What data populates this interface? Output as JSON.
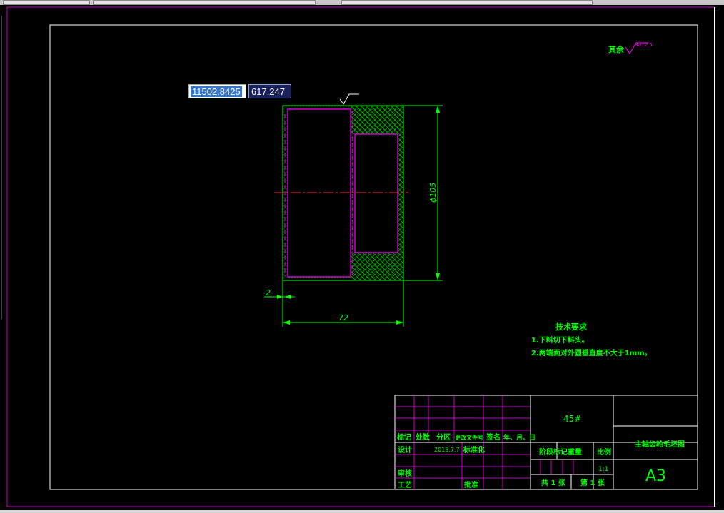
{
  "coords": {
    "x": "11502.8425",
    "y": "617.247"
  },
  "drawing": {
    "roughness_label": "其余",
    "roughness_value": "Ra12.5",
    "dim_diameter": "ϕ105",
    "dim_width": "72",
    "dim_offset": "2"
  },
  "tech": {
    "title": "技术要求",
    "items": [
      "1.下料切下料头。",
      "2.两端面对外圆垂直度不大于1mm。"
    ]
  },
  "title_block": {
    "material": "45#",
    "part_name": "主轴齿轮毛坯图",
    "sheet_size": "A3",
    "scale": "1:1",
    "date": "2019.7.7",
    "headers": [
      "标记",
      "处数",
      "分区",
      "更改文件号",
      "签名",
      "年、月、日"
    ],
    "design": "设计",
    "standardize": "标准化",
    "review": "审核",
    "process": "工艺",
    "approve": "批准",
    "stage": "阶段标记",
    "weight": "重量",
    "ratio": "比例",
    "total_sheets": "共 1 张",
    "sheet_no": "第 1 张"
  },
  "colors": {
    "frame": "#ffffff",
    "dimension": "#00ff00",
    "outline": "#ff00ff",
    "center": "#ff3333",
    "hatch": "#00cc00"
  }
}
